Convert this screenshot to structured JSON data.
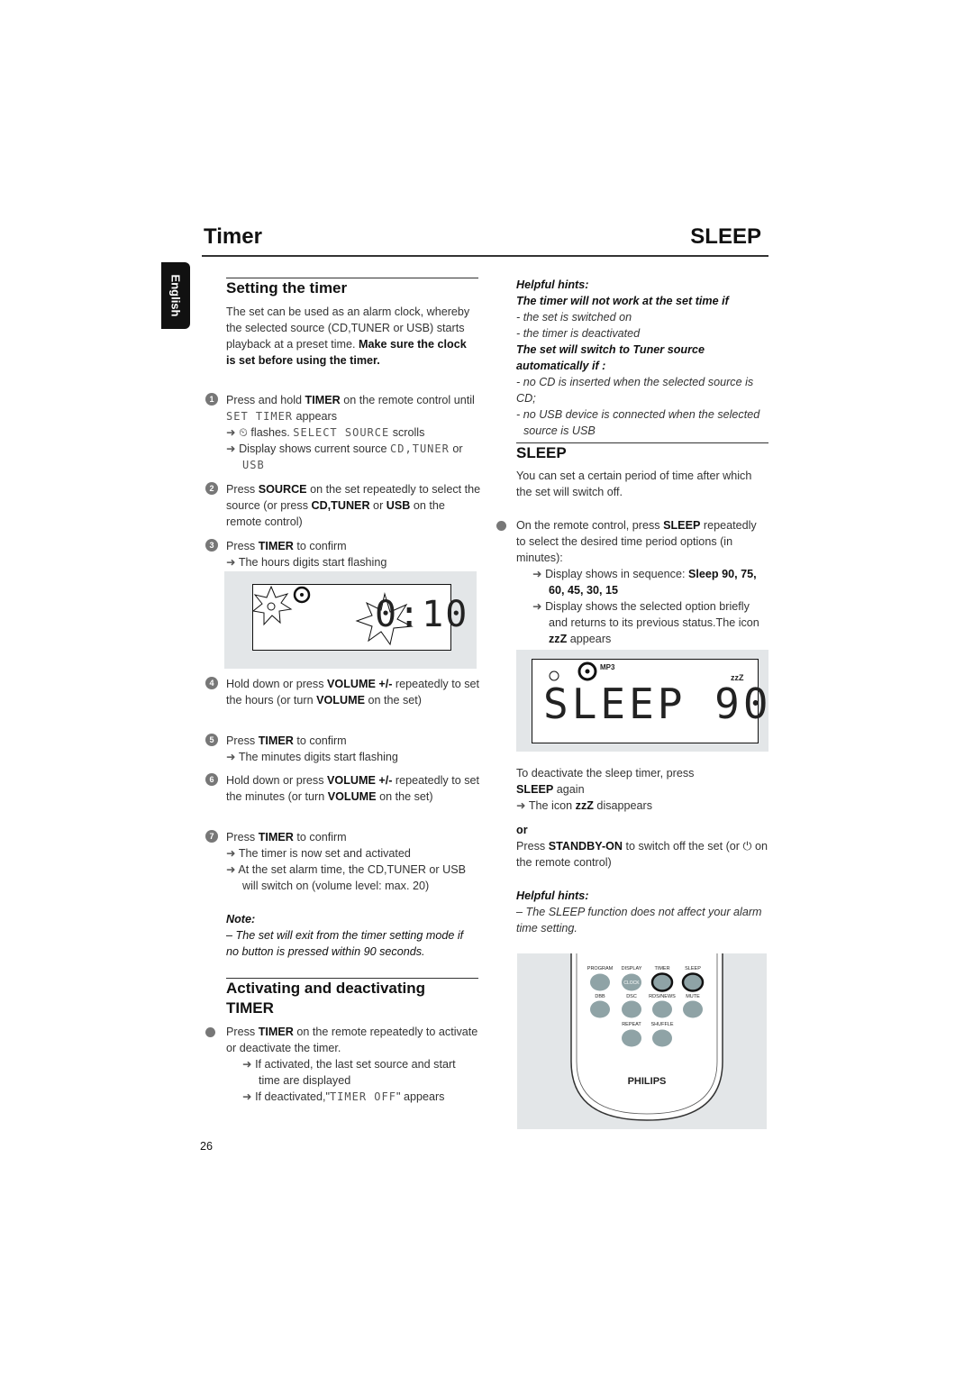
{
  "header": {
    "title_left": "Timer",
    "title_right": "SLEEP"
  },
  "side_tab": {
    "label": "English"
  },
  "page_number": "26",
  "setting": {
    "heading": "Setting the timer",
    "intro": [
      [
        "The set can be used as an alarm clock, whereby the selected source (CD,TUNER or USB) starts playback at a preset time. ",
        ""
      ],
      [
        "Make sure the clock is set before using the timer.",
        "b"
      ]
    ],
    "steps": [
      {
        "n": "1",
        "text": [
          [
            "Press and hold ",
            ""
          ],
          [
            "TIMER",
            "b"
          ],
          [
            " on the remote control until ",
            ""
          ],
          [
            "SET TIMER",
            "lcd"
          ],
          [
            " appears",
            ""
          ]
        ],
        "results": [
          [
            [
              "⏲ ",
              ""
            ],
            [
              "flashes. ",
              ""
            ],
            [
              "SELECT SOURCE",
              "lcd"
            ],
            [
              " scrolls",
              ""
            ]
          ],
          [
            [
              "Display shows current source ",
              ""
            ],
            [
              "CD,TUNER",
              "lcd"
            ],
            [
              " or ",
              ""
            ],
            [
              "USB",
              "lcd"
            ]
          ]
        ]
      },
      {
        "n": "2",
        "text": [
          [
            "Press ",
            ""
          ],
          [
            "SOURCE",
            "b"
          ],
          [
            " on the set repeatedly to select the source (or press ",
            ""
          ],
          [
            "CD,TUNER",
            "b"
          ],
          [
            " or ",
            ""
          ],
          [
            "USB",
            "b"
          ],
          [
            " on the remote control)",
            ""
          ]
        ],
        "results": []
      },
      {
        "n": "3",
        "text": [
          [
            "Press ",
            ""
          ],
          [
            "TIMER",
            "b"
          ],
          [
            " to confirm",
            ""
          ]
        ],
        "results": [
          [
            [
              "The hours digits start flashing",
              ""
            ]
          ]
        ]
      },
      {
        "n": "4",
        "text": [
          [
            "Hold down or press ",
            ""
          ],
          [
            "VOLUME +/-",
            "b"
          ],
          [
            " repeatedly to set the hours (or turn ",
            ""
          ],
          [
            "VOLUME",
            "b"
          ],
          [
            " on the set)",
            ""
          ]
        ],
        "results": []
      },
      {
        "n": "5",
        "text": [
          [
            "Press ",
            ""
          ],
          [
            "TIMER",
            "b"
          ],
          [
            " to confirm",
            ""
          ]
        ],
        "results": [
          [
            [
              "The minutes digits start flashing",
              ""
            ]
          ]
        ]
      },
      {
        "n": "6",
        "text": [
          [
            "Hold down or press ",
            ""
          ],
          [
            "VOLUME +/-",
            "b"
          ],
          [
            " repeatedly to set the minutes (or turn ",
            ""
          ],
          [
            "VOLUME",
            "b"
          ],
          [
            " on the set)",
            ""
          ]
        ],
        "results": []
      },
      {
        "n": "7",
        "text": [
          [
            "Press ",
            ""
          ],
          [
            "TIMER",
            "b"
          ],
          [
            " to confirm",
            ""
          ]
        ],
        "results": [
          [
            [
              "The timer is now set and activated",
              ""
            ]
          ],
          [
            [
              "At the set alarm time, the CD,TUNER or USB will switch on (volume level: max. 20)",
              ""
            ]
          ]
        ]
      }
    ],
    "display": {
      "digits": "0:10"
    },
    "note_label": "Note:",
    "note": "–  The set will exit from the timer setting mode if no button is pressed within 90 seconds."
  },
  "activating": {
    "heading": "Activating and deactivating TIMER",
    "text": [
      [
        "Press ",
        ""
      ],
      [
        "TIMER",
        "b"
      ],
      [
        " on the remote repeatedly to activate or deactivate the timer.",
        ""
      ]
    ],
    "results": [
      [
        [
          "If activated, the last set source and start time are displayed",
          ""
        ]
      ],
      [
        [
          "If deactivated,\"",
          ""
        ],
        [
          "TIMER OFF",
          "lcd"
        ],
        [
          "\" appears",
          ""
        ]
      ]
    ]
  },
  "hints1": {
    "label": "Helpful hints:",
    "items": [
      [
        [
          "The timer will not work at the set time if",
          "bi"
        ]
      ],
      [
        [
          "- the set is switched on",
          "i"
        ]
      ],
      [
        [
          "- the timer is deactivated",
          "i"
        ]
      ],
      [
        [
          "The set will switch to Tuner source automatically if :",
          "bi"
        ]
      ],
      [
        [
          "- no CD is inserted when the selected source is CD;",
          "i"
        ]
      ],
      [
        [
          "- no USB device is connected when the selected source is USB",
          "i"
        ]
      ]
    ]
  },
  "sleep": {
    "heading": "SLEEP",
    "intro": "You can set a certain period of time after which the set will switch off.",
    "text": [
      [
        "On the remote control, press ",
        ""
      ],
      [
        "SLEEP",
        "b"
      ],
      [
        " repeatedly to select the desired time period options (in minutes):",
        ""
      ]
    ],
    "results": [
      [
        [
          "Display shows in sequence: ",
          ""
        ],
        [
          "Sleep 90,  75, 60, 45, 30, 15",
          "b"
        ]
      ],
      [
        [
          "Display shows the selected option briefly and returns to its previous status.The icon ",
          ""
        ],
        [
          "zzZ",
          "b"
        ],
        [
          " appears",
          ""
        ]
      ]
    ],
    "display": {
      "text": "SLEEP 90",
      "mp3": "MP3",
      "zzz": "zzZ"
    },
    "deactivate": [
      [
        "To deactivate the sleep timer",
        ""
      ],
      [
        ", press ",
        ""
      ],
      [
        "SLEEP",
        "b"
      ],
      [
        " again",
        ""
      ]
    ],
    "deactivate_result": [
      [
        "The icon ",
        ""
      ],
      [
        "zzZ",
        "b"
      ],
      [
        " disappears",
        ""
      ]
    ],
    "or": "or",
    "standby": [
      [
        "Press ",
        ""
      ],
      [
        "STANDBY-ON",
        "b"
      ],
      [
        " to switch off the set  (or ⏻ on the remote control)",
        ""
      ]
    ]
  },
  "hints2": {
    "label": "Helpful hints:",
    "text": "–  The SLEEP function does not affect your alarm time setting."
  },
  "remote": {
    "row1": [
      "PROGRAM",
      "DISPLAY",
      "TIMER",
      "SLEEP"
    ],
    "clock": "CLOCK",
    "row2": [
      "DBB",
      "DSC",
      "RDS/NEWS",
      "MUTE"
    ],
    "row3": [
      "REPEAT",
      "SHUFFLE"
    ],
    "brand": "PHILIPS",
    "button_color": "#8fa3a6"
  }
}
